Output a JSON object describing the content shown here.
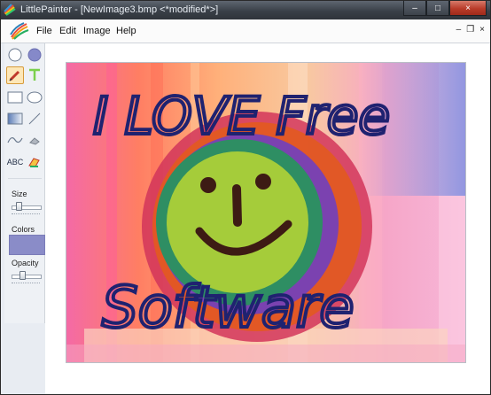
{
  "window": {
    "title": "LittlePainter - [NewImage3.bmp  <*modified*>]",
    "caption_buttons": {
      "minimize": "–",
      "maximize": "□",
      "close": "×"
    }
  },
  "menubar": {
    "items": [
      {
        "label": "File"
      },
      {
        "label": "Edit"
      },
      {
        "label": "Image"
      },
      {
        "label": "Help"
      }
    ],
    "mdi_buttons": {
      "minimize": "–",
      "restore": "❐",
      "close": "×"
    }
  },
  "toolbox": {
    "tools": [
      {
        "icon": "ellipse-outline-icon"
      },
      {
        "icon": "ellipse-filled-icon"
      },
      {
        "icon": "pencil-icon",
        "selected": true
      },
      {
        "icon": "text-cursor-icon"
      },
      {
        "icon": "rectangle-icon"
      },
      {
        "icon": "ellipse-icon"
      },
      {
        "icon": "gradient-icon"
      },
      {
        "icon": "line-icon"
      },
      {
        "icon": "curve-icon"
      },
      {
        "icon": "eraser-icon"
      },
      {
        "icon": "text-tool-icon",
        "label": "ABC"
      },
      {
        "icon": "fill-icon"
      }
    ],
    "size_label": "Size",
    "colors_label": "Colors",
    "opacity_label": "Opacity",
    "current_color": "#8a8cc8",
    "size_value_fraction": 0.2,
    "opacity_value_fraction": 0.35
  },
  "canvas": {
    "text_line1": "I LOVE Free",
    "text_line2": "Software"
  }
}
